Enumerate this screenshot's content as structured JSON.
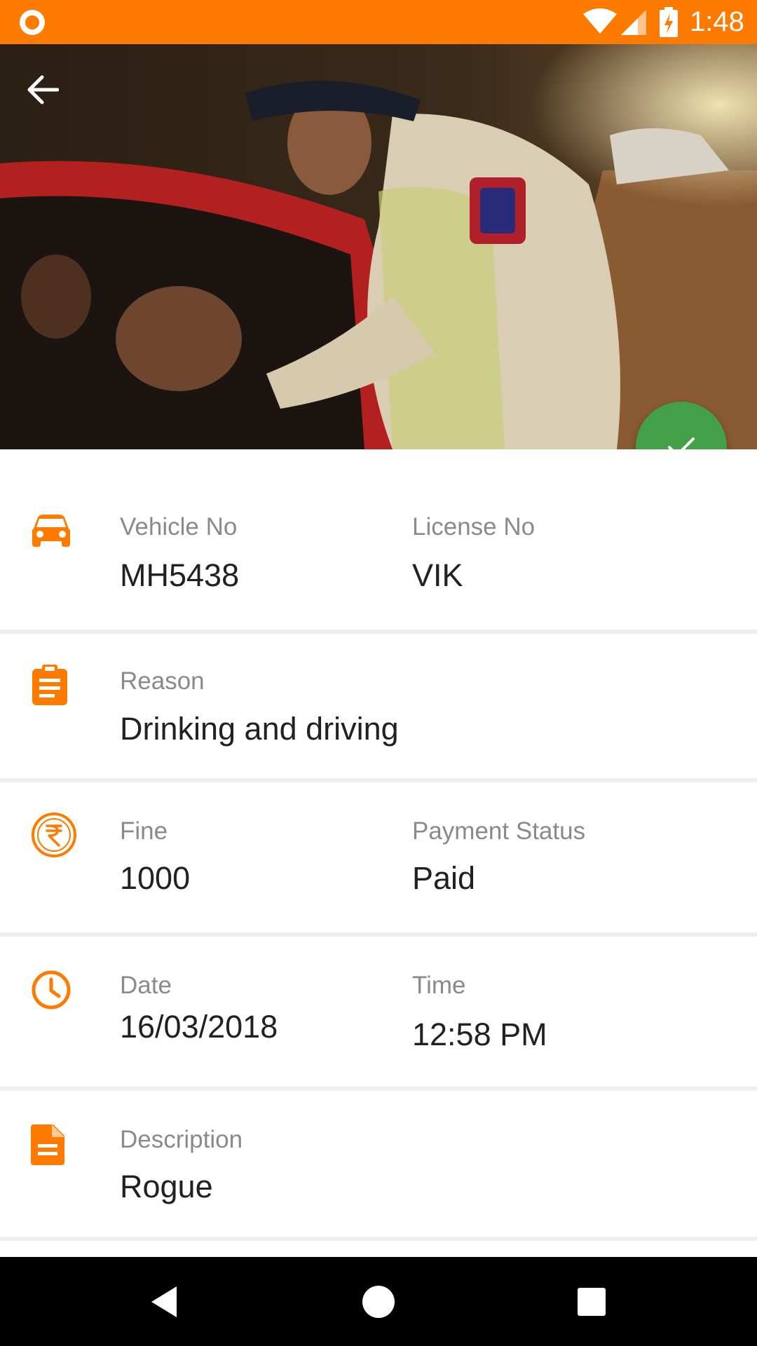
{
  "status_bar": {
    "time": "1:48"
  },
  "fields": {
    "vehicle": {
      "label": "Vehicle No",
      "value": "MH5438"
    },
    "license": {
      "label": "License No",
      "value": "VIK"
    },
    "reason": {
      "label": "Reason",
      "value": "Drinking and driving"
    },
    "fine": {
      "label": "Fine",
      "value": "1000"
    },
    "payment_status": {
      "label": "Payment Status",
      "value": "Paid"
    },
    "date": {
      "label": "Date",
      "value": "16/03/2018"
    },
    "time": {
      "label": "Time",
      "value": "12:58 PM"
    },
    "description": {
      "label": "Description",
      "value": "Rogue"
    }
  },
  "colors": {
    "accent": "#FF7B00",
    "fab": "#43A047",
    "label": "#8a8a8a",
    "value": "#212121"
  },
  "icons": {
    "back": "arrow-left-icon",
    "fab": "check-icon",
    "vehicle": "car-icon",
    "reason": "clipboard-icon",
    "fine": "rupee-icon",
    "date": "clock-icon",
    "description": "document-icon"
  }
}
